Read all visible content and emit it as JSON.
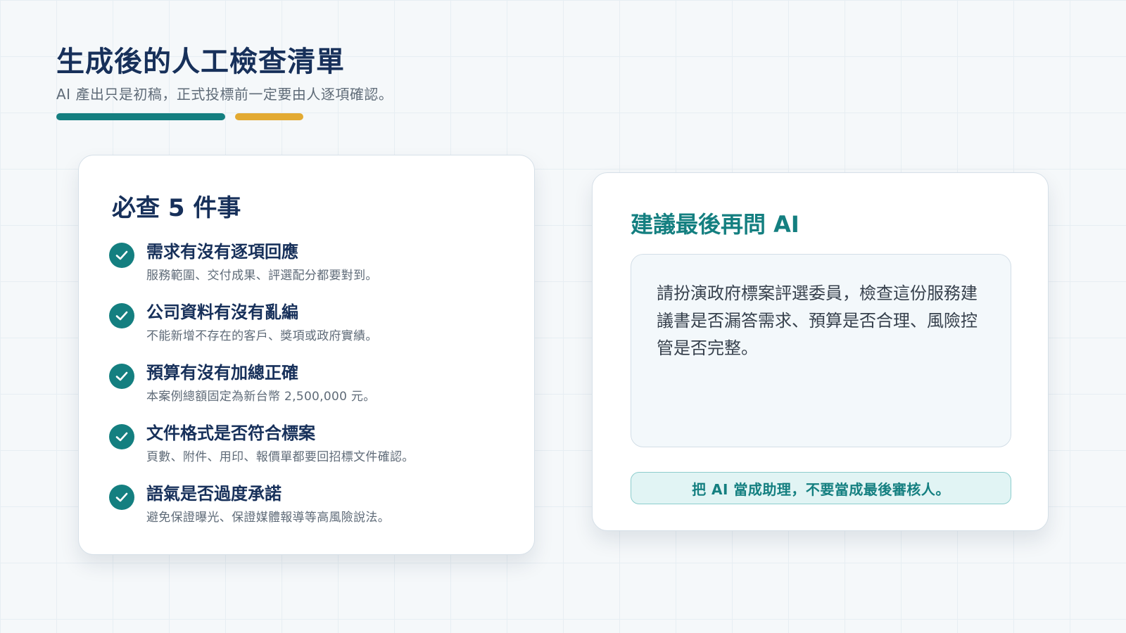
{
  "header": {
    "title": "生成後的人工檢查清單",
    "subtitle": "AI 產出只是初稿，正式投標前一定要由人逐項確認。"
  },
  "checklist_card": {
    "title": "必查 5 件事",
    "items": [
      {
        "title": "需求有沒有逐項回應",
        "desc": "服務範圍、交付成果、評選配分都要對到。"
      },
      {
        "title": "公司資料有沒有亂編",
        "desc": "不能新增不存在的客戶、獎項或政府實績。"
      },
      {
        "title": "預算有沒有加總正確",
        "desc": "本案例總額固定為新台幣 2,500,000 元。"
      },
      {
        "title": "文件格式是否符合標案",
        "desc": "頁數、附件、用印、報價單都要回招標文件確認。"
      },
      {
        "title": "語氣是否過度承諾",
        "desc": "避免保證曝光、保證媒體報導等高風險說法。"
      }
    ]
  },
  "prompt_card": {
    "title": "建議最後再問 AI",
    "prompt": "請扮演政府標案評選委員，檢查這份服務建議書是否漏答需求、預算是否合理、風險控管是否完整。",
    "tip": "把 AI 當成助理，不要當成最後審核人。"
  },
  "colors": {
    "teal": "#147f80",
    "gold": "#e3aa32",
    "navy": "#17305a"
  },
  "icons": {
    "check": "check-circle-icon"
  }
}
